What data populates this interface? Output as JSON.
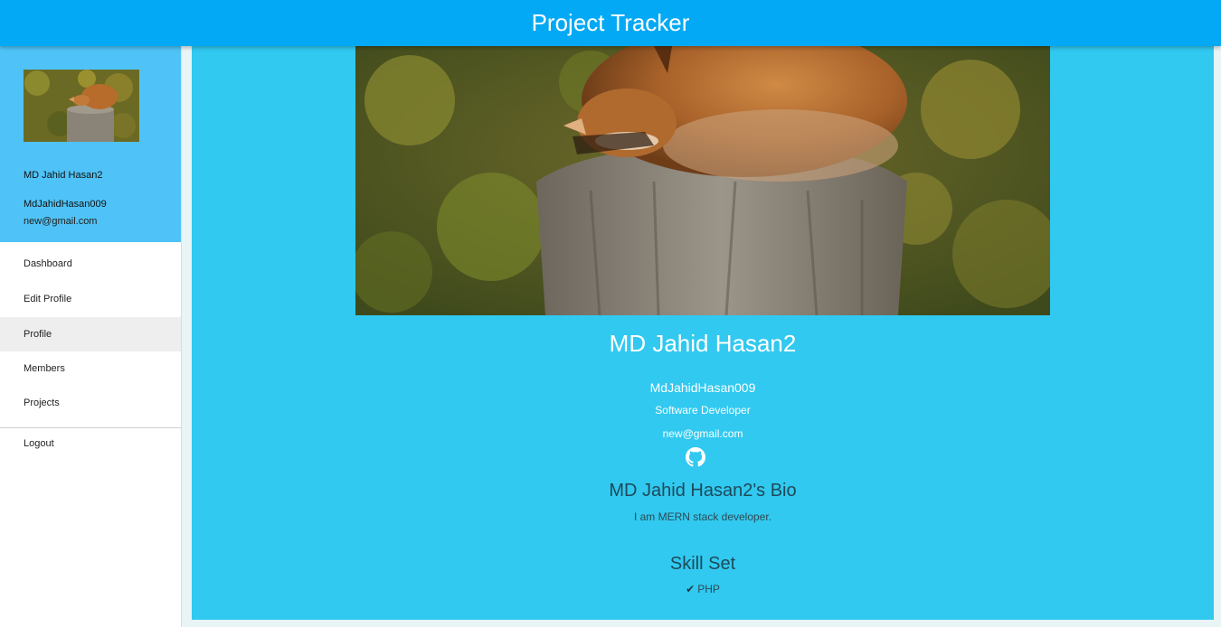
{
  "header": {
    "title": "Project Tracker"
  },
  "sidebar": {
    "avatar_icon": "fox-photo",
    "name": "MD Jahid Hasan2",
    "username": "MdJahidHasan009",
    "email": "new@gmail.com",
    "items": [
      {
        "label": "Dashboard"
      },
      {
        "label": "Edit Profile"
      },
      {
        "label": "Profile"
      },
      {
        "label": "Members"
      },
      {
        "label": "Projects"
      },
      {
        "label": "Logout"
      }
    ],
    "active_item": "Profile"
  },
  "profile": {
    "cover_icon": "fox-photo",
    "name": "MD Jahid Hasan2",
    "username": "MdJahidHasan009",
    "title": "Software Developer",
    "email": "new@gmail.com",
    "github_icon": "github-icon",
    "bio_heading": "MD Jahid Hasan2's Bio",
    "bio": "I am MERN stack developer.",
    "skills_heading": "Skill Set",
    "skills": [
      "PHP"
    ]
  },
  "colors": {
    "header": "#03a9f4",
    "sidebar_profile": "#4fc3f7",
    "main": "#31c9f0"
  }
}
